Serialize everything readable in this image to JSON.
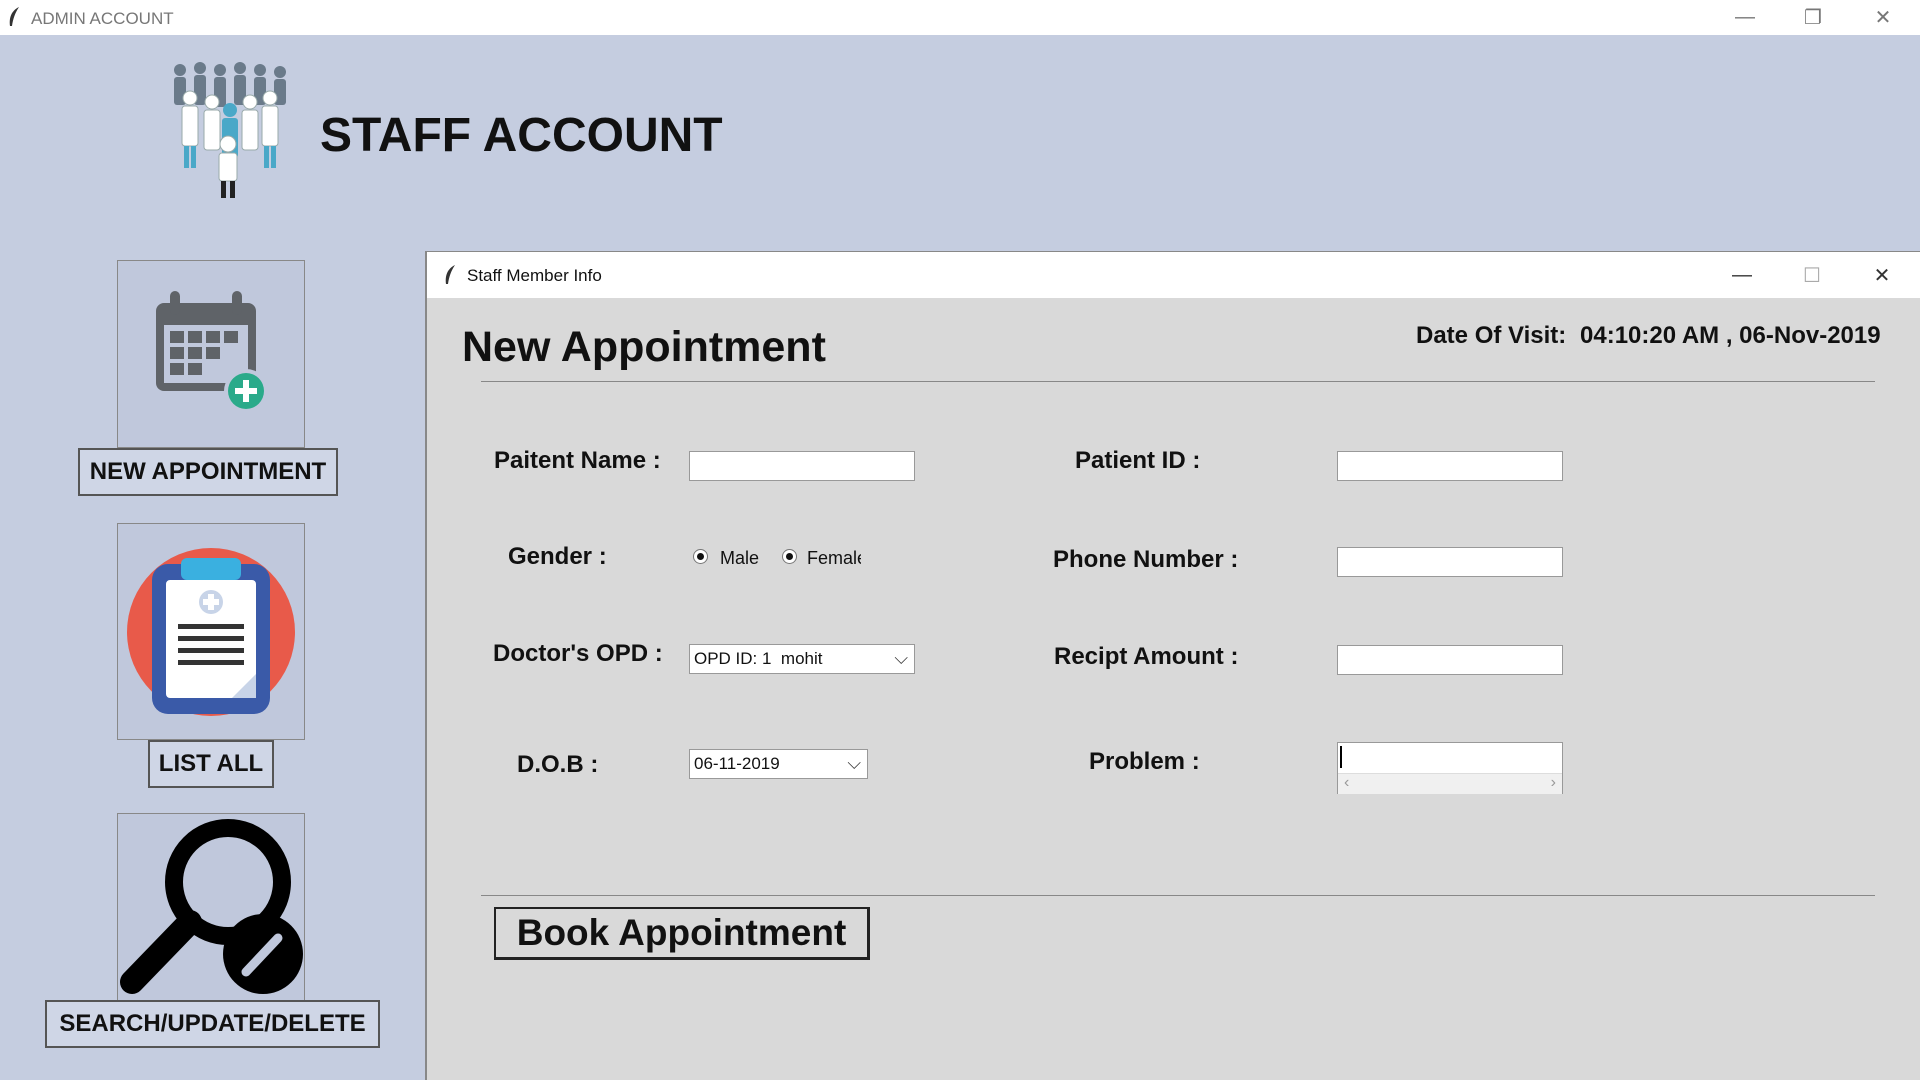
{
  "app": {
    "title": "ADMIN ACCOUNT",
    "heading": "STAFF ACCOUNT"
  },
  "sidebar": {
    "new_appointment": "NEW APPOINTMENT",
    "list_all": "LIST ALL",
    "search": "SEARCH/UPDATE/DELETE"
  },
  "dialog": {
    "title": "Staff Member Info",
    "heading": "New Appointment",
    "date_label": "Date Of Visit:",
    "date_value": "04:10:20 AM , 06-Nov-2019",
    "fields": {
      "patient_name": "Paitent Name :",
      "patient_id": "Patient ID :",
      "gender": "Gender :",
      "phone": "Phone Number :",
      "doctor_opd": "Doctor's OPD :",
      "receipt": "Recipt Amount :",
      "dob": "D.O.B :",
      "problem": "Problem :"
    },
    "gender_options": {
      "male": "Male",
      "female": "Female"
    },
    "doctor_opd_value": "OPD ID: 1  mohit",
    "dob_value": "06-11-2019",
    "book_button": "Book Appointment"
  },
  "icons": {
    "app": "feather-icon",
    "new_appointment": "calendar-add-icon",
    "list_all": "clipboard-icon",
    "search": "search-edit-icon",
    "heading": "staff-group-icon"
  }
}
